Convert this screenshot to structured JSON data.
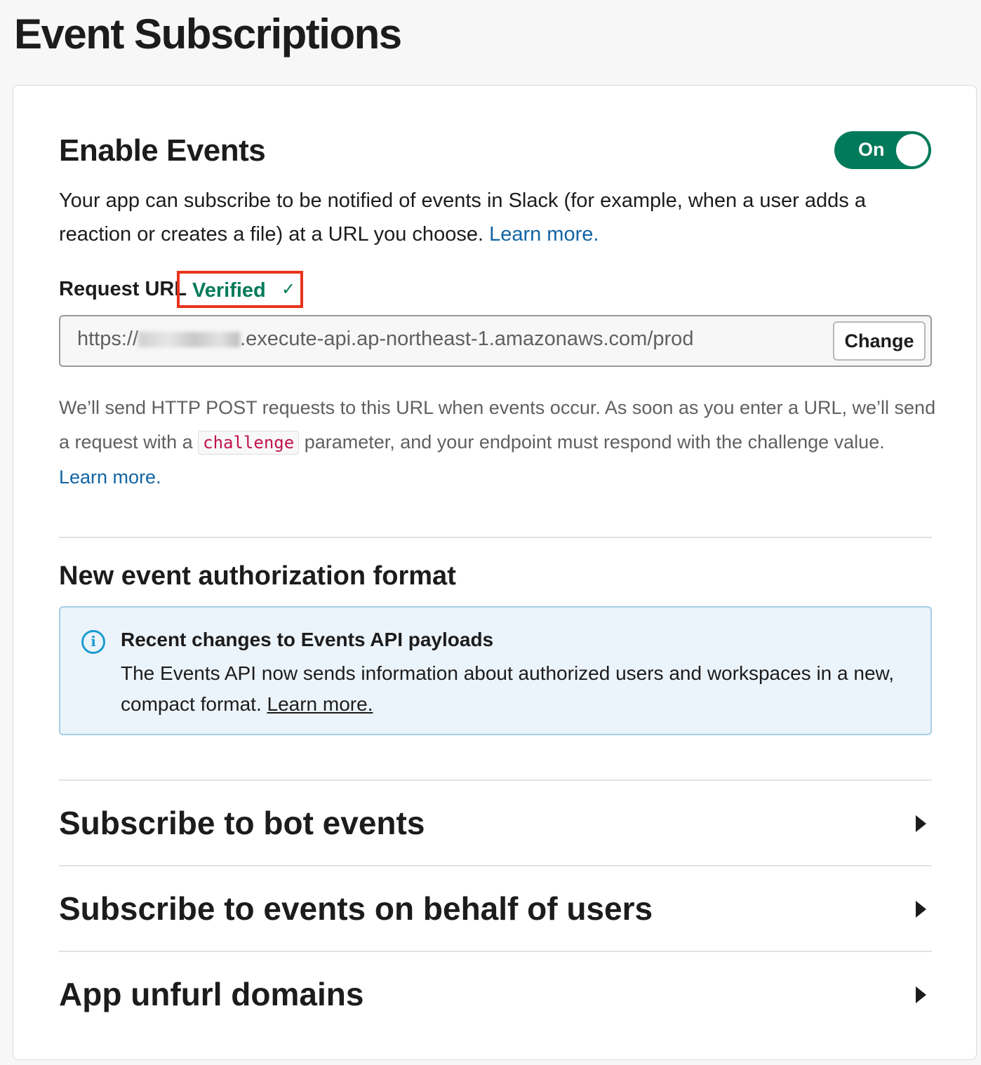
{
  "page": {
    "title": "Event Subscriptions"
  },
  "enable_events": {
    "title": "Enable Events",
    "toggle_label": "On",
    "description": "Your app can subscribe to be notified of events in Slack (for example, when a user adds a reaction or creates a file) at a URL you choose.",
    "learn_more": "Learn more."
  },
  "request_url": {
    "label": "Request URL",
    "status": "Verified",
    "status_icon": "checkmark-icon",
    "url_prefix": "https://",
    "url_suffix": ".execute-api.ap-northeast-1.amazonaws.com/prod",
    "change_button": "Change",
    "help_part1": "We’ll send HTTP POST requests to this URL when events occur. As soon as you enter a URL, we’ll send a request with a",
    "help_code": "challenge",
    "help_part2": "parameter, and your endpoint must respond with the challenge value.",
    "help_learn_more": "Learn more."
  },
  "auth_format": {
    "title": "New event authorization format",
    "notice_title": "Recent changes to Events API payloads",
    "notice_body": "The Events API now sends information about authorized users and workspaces in a new, compact format.",
    "notice_link": "Learn more."
  },
  "sections": [
    {
      "title": "Subscribe to bot events"
    },
    {
      "title": "Subscribe to events on behalf of users"
    },
    {
      "title": "App unfurl domains"
    }
  ],
  "colors": {
    "accent_green": "#007a5a",
    "link_blue": "#1264a3",
    "highlight_red": "#e8341c",
    "info_bg": "#ebf4fa"
  }
}
